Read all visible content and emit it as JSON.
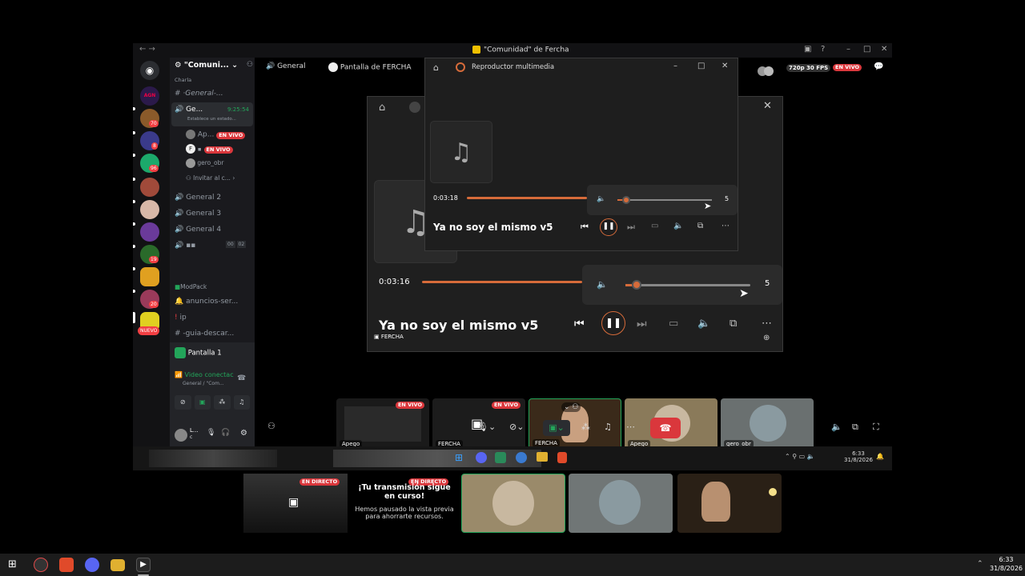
{
  "window": {
    "title": "\"Comunidad\" de Fercha"
  },
  "server": {
    "name": "\"Comuni...",
    "category": "Charla",
    "channels": [
      {
        "name": "·General-..."
      },
      {
        "name": "Ge...",
        "timer": "9:25:54",
        "status": "Establece un estado..."
      }
    ],
    "voice_members": [
      {
        "name": "Ap...",
        "badge": "EN VIVO"
      },
      {
        "name": "F",
        "badge": "EN VIVO"
      },
      {
        "name": "gero_obr"
      }
    ],
    "invite": "Invitar al c...",
    "voice_channels": [
      "General 2",
      "General 3",
      "General 4"
    ],
    "extra_channel_counts": [
      "00",
      "02"
    ],
    "modpack_category": "ModPack",
    "text_channels": [
      "anuncios-ser...",
      "ip",
      "-guia-descar..."
    ],
    "new_badge": "NUEVO"
  },
  "guild_badges": [
    "70",
    "8",
    "96",
    "19",
    "20"
  ],
  "guild_labels": [
    "AGN"
  ],
  "voice_panel": {
    "stream_name": "Pantalla 1",
    "status": "Video conectac",
    "location": "General / \"Com..."
  },
  "user_panel": {
    "name": "L...",
    "sub": "c"
  },
  "call_header": {
    "channel": "General",
    "screen_owner": "Pantalla de FERCHA",
    "quality": "720p 30 FPS",
    "live": "EN VIVO"
  },
  "player_front": {
    "app_title": "Reproductor multimedia",
    "time": "0:03:18",
    "song": "Ya no soy el mismo v5",
    "volume": "5",
    "progress": 0.6,
    "volume_level": 0.05
  },
  "player_back": {
    "time": "0:03:16",
    "song": "Ya no soy el mismo v5",
    "volume": "5",
    "owner": "FERCHA",
    "progress": 0.6,
    "volume_level": 0.05
  },
  "tiles": [
    {
      "name": "Apego",
      "badge": "EN VIVO"
    },
    {
      "name": "FERCHA",
      "badge": "EN VIVO"
    },
    {
      "name": "FERCHA"
    },
    {
      "name": "Apego"
    },
    {
      "name": "gero_obr"
    }
  ],
  "inner_taskbar": {
    "time": "6:33",
    "date": "31/8/2026"
  },
  "preview_row": {
    "badge1": "EN DIRECTO",
    "badge2": "EN DIRECTO",
    "paused_title": "¡Tu transmisión sigue en curso!",
    "paused_body": "Hemos pausado la vista previa para ahorrarte recursos."
  },
  "taskbar": {
    "time": "6:33",
    "date": "31/8/2026"
  },
  "colors": {
    "accent_orange": "#d66b3a",
    "live_red": "#da373c",
    "connected_green": "#23a55a",
    "discord_blurple": "#5865f2"
  }
}
